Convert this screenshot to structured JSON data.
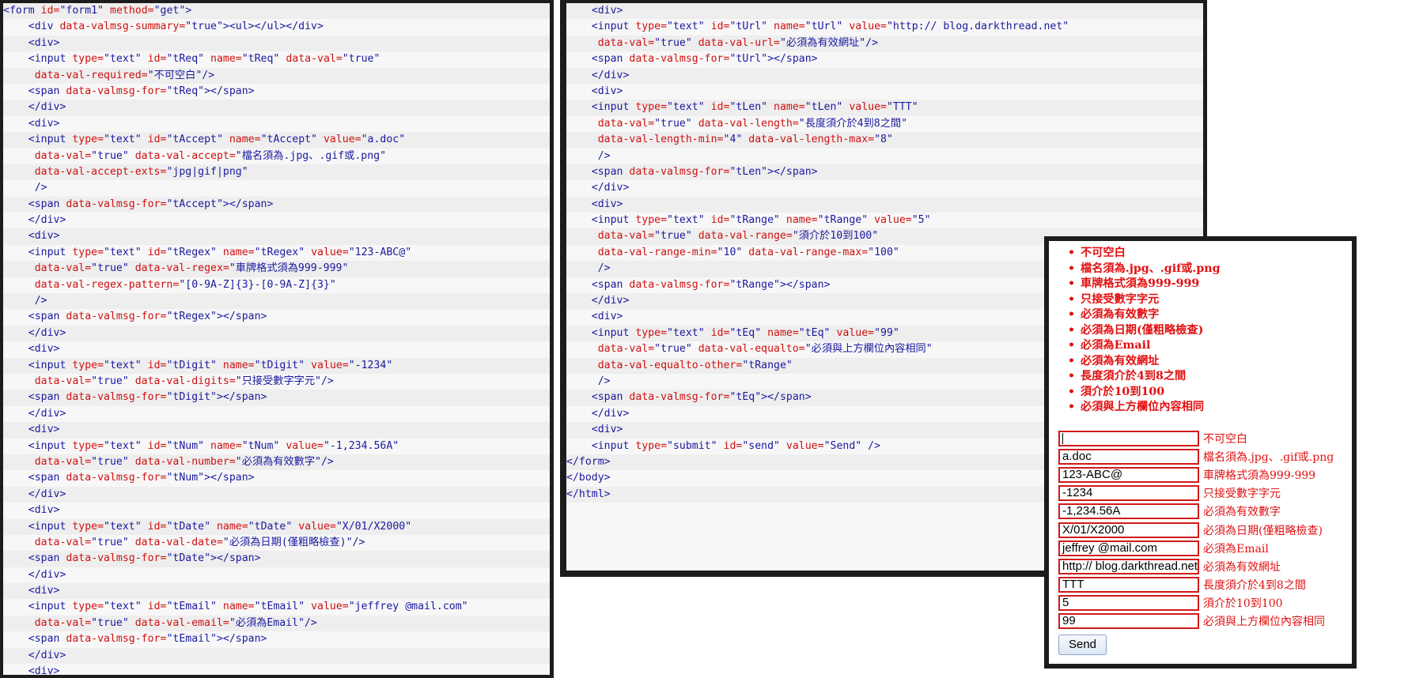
{
  "left_code": [
    [
      [
        "t",
        "<form "
      ],
      [
        "a",
        "id="
      ],
      [
        "v",
        "\"form1\" "
      ],
      [
        "a",
        "method="
      ],
      [
        "v",
        "\"get\""
      ],
      [
        "t",
        ">"
      ]
    ],
    [
      [
        "t",
        "    <div "
      ],
      [
        "a",
        "data-valmsg-summary="
      ],
      [
        "v",
        "\"true\""
      ],
      [
        "t",
        "><ul></ul></div>"
      ]
    ],
    [
      [
        "t",
        "    <div>"
      ]
    ],
    [
      [
        "t",
        "    <input "
      ],
      [
        "a",
        "type="
      ],
      [
        "v",
        "\"text\" "
      ],
      [
        "a",
        "id="
      ],
      [
        "v",
        "\"tReq\" "
      ],
      [
        "a",
        "name="
      ],
      [
        "v",
        "\"tReq\" "
      ],
      [
        "a",
        "data-val="
      ],
      [
        "v",
        "\"true\""
      ]
    ],
    [
      [
        "a",
        "     data-val-required="
      ],
      [
        "v",
        "\"不可空白\""
      ],
      [
        "t",
        "/>"
      ]
    ],
    [
      [
        "t",
        "    <span "
      ],
      [
        "a",
        "data-valmsg-for="
      ],
      [
        "v",
        "\"tReq\""
      ],
      [
        "t",
        "></span>"
      ]
    ],
    [
      [
        "t",
        "    </div>"
      ]
    ],
    [
      [
        "t",
        "    <div>"
      ]
    ],
    [
      [
        "t",
        "    <input "
      ],
      [
        "a",
        "type="
      ],
      [
        "v",
        "\"text\" "
      ],
      [
        "a",
        "id="
      ],
      [
        "v",
        "\"tAccept\" "
      ],
      [
        "a",
        "name="
      ],
      [
        "v",
        "\"tAccept\" "
      ],
      [
        "a",
        "value="
      ],
      [
        "v",
        "\"a.doc\""
      ]
    ],
    [
      [
        "a",
        "     data-val="
      ],
      [
        "v",
        "\"true\" "
      ],
      [
        "a",
        "data-val-accept="
      ],
      [
        "v",
        "\"檔名須為.jpg、.gif或.png\""
      ]
    ],
    [
      [
        "a",
        "     data-val-accept-exts="
      ],
      [
        "v",
        "\"jpg|gif|png\""
      ]
    ],
    [
      [
        "t",
        "     />"
      ]
    ],
    [
      [
        "t",
        "    <span "
      ],
      [
        "a",
        "data-valmsg-for="
      ],
      [
        "v",
        "\"tAccept\""
      ],
      [
        "t",
        "></span>"
      ]
    ],
    [
      [
        "t",
        "    </div>"
      ]
    ],
    [
      [
        "t",
        "    <div>"
      ]
    ],
    [
      [
        "t",
        "    <input "
      ],
      [
        "a",
        "type="
      ],
      [
        "v",
        "\"text\" "
      ],
      [
        "a",
        "id="
      ],
      [
        "v",
        "\"tRegex\" "
      ],
      [
        "a",
        "name="
      ],
      [
        "v",
        "\"tRegex\" "
      ],
      [
        "a",
        "value="
      ],
      [
        "v",
        "\"123-ABC@\""
      ]
    ],
    [
      [
        "a",
        "     data-val="
      ],
      [
        "v",
        "\"true\" "
      ],
      [
        "a",
        "data-val-regex="
      ],
      [
        "v",
        "\"車牌格式須為999-999\""
      ]
    ],
    [
      [
        "a",
        "     data-val-regex-pattern="
      ],
      [
        "v",
        "\"[0-9A-Z]{3}-[0-9A-Z]{3}\""
      ]
    ],
    [
      [
        "t",
        "     />"
      ]
    ],
    [
      [
        "t",
        "    <span "
      ],
      [
        "a",
        "data-valmsg-for="
      ],
      [
        "v",
        "\"tRegex\""
      ],
      [
        "t",
        "></span>"
      ]
    ],
    [
      [
        "t",
        "    </div>"
      ]
    ],
    [
      [
        "t",
        "    <div>"
      ]
    ],
    [
      [
        "t",
        "    <input "
      ],
      [
        "a",
        "type="
      ],
      [
        "v",
        "\"text\" "
      ],
      [
        "a",
        "id="
      ],
      [
        "v",
        "\"tDigit\" "
      ],
      [
        "a",
        "name="
      ],
      [
        "v",
        "\"tDigit\" "
      ],
      [
        "a",
        "value="
      ],
      [
        "v",
        "\"-1234\""
      ]
    ],
    [
      [
        "a",
        "     data-val="
      ],
      [
        "v",
        "\"true\" "
      ],
      [
        "a",
        "data-val-digits="
      ],
      [
        "v",
        "\"只接受數字字元\""
      ],
      [
        "t",
        "/>"
      ]
    ],
    [
      [
        "t",
        "    <span "
      ],
      [
        "a",
        "data-valmsg-for="
      ],
      [
        "v",
        "\"tDigit\""
      ],
      [
        "t",
        "></span>"
      ]
    ],
    [
      [
        "t",
        "    </div>"
      ]
    ],
    [
      [
        "t",
        "    <div>"
      ]
    ],
    [
      [
        "t",
        "    <input "
      ],
      [
        "a",
        "type="
      ],
      [
        "v",
        "\"text\" "
      ],
      [
        "a",
        "id="
      ],
      [
        "v",
        "\"tNum\" "
      ],
      [
        "a",
        "name="
      ],
      [
        "v",
        "\"tNum\" "
      ],
      [
        "a",
        "value="
      ],
      [
        "v",
        "\"-1,234.56A\""
      ]
    ],
    [
      [
        "a",
        "     data-val="
      ],
      [
        "v",
        "\"true\" "
      ],
      [
        "a",
        "data-val-number="
      ],
      [
        "v",
        "\"必須為有效數字\""
      ],
      [
        "t",
        "/>"
      ]
    ],
    [
      [
        "t",
        "    <span "
      ],
      [
        "a",
        "data-valmsg-for="
      ],
      [
        "v",
        "\"tNum\""
      ],
      [
        "t",
        "></span>"
      ]
    ],
    [
      [
        "t",
        "    </div>"
      ]
    ],
    [
      [
        "t",
        "    <div>"
      ]
    ],
    [
      [
        "t",
        "    <input "
      ],
      [
        "a",
        "type="
      ],
      [
        "v",
        "\"text\" "
      ],
      [
        "a",
        "id="
      ],
      [
        "v",
        "\"tDate\" "
      ],
      [
        "a",
        "name="
      ],
      [
        "v",
        "\"tDate\" "
      ],
      [
        "a",
        "value="
      ],
      [
        "v",
        "\"X/01/X2000\""
      ]
    ],
    [
      [
        "a",
        "     data-val="
      ],
      [
        "v",
        "\"true\" "
      ],
      [
        "a",
        "data-val-date="
      ],
      [
        "v",
        "\"必須為日期(僅粗略檢查)\""
      ],
      [
        "t",
        "/>"
      ]
    ],
    [
      [
        "t",
        "    <span "
      ],
      [
        "a",
        "data-valmsg-for="
      ],
      [
        "v",
        "\"tDate\""
      ],
      [
        "t",
        "></span>"
      ]
    ],
    [
      [
        "t",
        "    </div>"
      ]
    ],
    [
      [
        "t",
        "    <div>"
      ]
    ],
    [
      [
        "t",
        "    <input "
      ],
      [
        "a",
        "type="
      ],
      [
        "v",
        "\"text\" "
      ],
      [
        "a",
        "id="
      ],
      [
        "v",
        "\"tEmail\" "
      ],
      [
        "a",
        "name="
      ],
      [
        "v",
        "\"tEmail\" "
      ],
      [
        "a",
        "value="
      ],
      [
        "v",
        "\"jeffrey @mail.com\""
      ]
    ],
    [
      [
        "a",
        "     data-val="
      ],
      [
        "v",
        "\"true\" "
      ],
      [
        "a",
        "data-val-email="
      ],
      [
        "v",
        "\"必須為Email\""
      ],
      [
        "t",
        "/>"
      ]
    ],
    [
      [
        "t",
        "    <span "
      ],
      [
        "a",
        "data-valmsg-for="
      ],
      [
        "v",
        "\"tEmail\""
      ],
      [
        "t",
        "></span>"
      ]
    ],
    [
      [
        "t",
        "    </div>"
      ]
    ],
    [
      [
        "t",
        "    <div>"
      ]
    ]
  ],
  "middle_code": [
    [
      [
        "t",
        "    <div>"
      ]
    ],
    [
      [
        "t",
        "    <input "
      ],
      [
        "a",
        "type="
      ],
      [
        "v",
        "\"text\" "
      ],
      [
        "a",
        "id="
      ],
      [
        "v",
        "\"tUrl\" "
      ],
      [
        "a",
        "name="
      ],
      [
        "v",
        "\"tUrl\" "
      ],
      [
        "a",
        "value="
      ],
      [
        "v",
        "\"http:// blog.darkthread.net\""
      ]
    ],
    [
      [
        "a",
        "     data-val="
      ],
      [
        "v",
        "\"true\" "
      ],
      [
        "a",
        "data-val-url="
      ],
      [
        "v",
        "\"必須為有效網址\""
      ],
      [
        "t",
        "/>"
      ]
    ],
    [
      [
        "t",
        "    <span "
      ],
      [
        "a",
        "data-valmsg-for="
      ],
      [
        "v",
        "\"tUrl\""
      ],
      [
        "t",
        "></span>"
      ]
    ],
    [
      [
        "t",
        "    </div>"
      ]
    ],
    [
      [
        "t",
        "    <div>"
      ]
    ],
    [
      [
        "t",
        "    <input "
      ],
      [
        "a",
        "type="
      ],
      [
        "v",
        "\"text\" "
      ],
      [
        "a",
        "id="
      ],
      [
        "v",
        "\"tLen\" "
      ],
      [
        "a",
        "name="
      ],
      [
        "v",
        "\"tLen\" "
      ],
      [
        "a",
        "value="
      ],
      [
        "v",
        "\"TTT\""
      ]
    ],
    [
      [
        "a",
        "     data-val="
      ],
      [
        "v",
        "\"true\" "
      ],
      [
        "a",
        "data-val-length="
      ],
      [
        "v",
        "\"長度須介於4到8之間\""
      ]
    ],
    [
      [
        "a",
        "     data-val-length-min="
      ],
      [
        "v",
        "\"4\" "
      ],
      [
        "a",
        "data-val-length-max="
      ],
      [
        "v",
        "\"8\""
      ]
    ],
    [
      [
        "t",
        "     />"
      ]
    ],
    [
      [
        "t",
        "    <span "
      ],
      [
        "a",
        "data-valmsg-for="
      ],
      [
        "v",
        "\"tLen\""
      ],
      [
        "t",
        "></span>"
      ]
    ],
    [
      [
        "t",
        "    </div>"
      ]
    ],
    [
      [
        "t",
        "    <div>"
      ]
    ],
    [
      [
        "t",
        "    <input "
      ],
      [
        "a",
        "type="
      ],
      [
        "v",
        "\"text\" "
      ],
      [
        "a",
        "id="
      ],
      [
        "v",
        "\"tRange\" "
      ],
      [
        "a",
        "name="
      ],
      [
        "v",
        "\"tRange\" "
      ],
      [
        "a",
        "value="
      ],
      [
        "v",
        "\"5\""
      ]
    ],
    [
      [
        "a",
        "     data-val="
      ],
      [
        "v",
        "\"true\" "
      ],
      [
        "a",
        "data-val-range="
      ],
      [
        "v",
        "\"須介於10到100\""
      ]
    ],
    [
      [
        "a",
        "     data-val-range-min="
      ],
      [
        "v",
        "\"10\" "
      ],
      [
        "a",
        "data-val-range-max="
      ],
      [
        "v",
        "\"100\""
      ]
    ],
    [
      [
        "t",
        "     />"
      ]
    ],
    [
      [
        "t",
        "    <span "
      ],
      [
        "a",
        "data-valmsg-for="
      ],
      [
        "v",
        "\"tRange\""
      ],
      [
        "t",
        "></span>"
      ]
    ],
    [
      [
        "t",
        "    </div>"
      ]
    ],
    [
      [
        "t",
        "    <div>"
      ]
    ],
    [
      [
        "t",
        "    <input "
      ],
      [
        "a",
        "type="
      ],
      [
        "v",
        "\"text\" "
      ],
      [
        "a",
        "id="
      ],
      [
        "v",
        "\"tEq\" "
      ],
      [
        "a",
        "name="
      ],
      [
        "v",
        "\"tEq\" "
      ],
      [
        "a",
        "value="
      ],
      [
        "v",
        "\"99\""
      ]
    ],
    [
      [
        "a",
        "     data-val="
      ],
      [
        "v",
        "\"true\" "
      ],
      [
        "a",
        "data-val-equalto="
      ],
      [
        "v",
        "\"必須與上方欄位內容相同\""
      ]
    ],
    [
      [
        "a",
        "     data-val-equalto-other="
      ],
      [
        "v",
        "\"tRange\""
      ]
    ],
    [
      [
        "t",
        "     />"
      ]
    ],
    [
      [
        "t",
        "    <span "
      ],
      [
        "a",
        "data-valmsg-for="
      ],
      [
        "v",
        "\"tEq\""
      ],
      [
        "t",
        "></span>"
      ]
    ],
    [
      [
        "t",
        "    </div>"
      ]
    ],
    [
      [
        "t",
        "    <div>"
      ]
    ],
    [
      [
        "t",
        "    <input "
      ],
      [
        "a",
        "type="
      ],
      [
        "v",
        "\"submit\" "
      ],
      [
        "a",
        "id="
      ],
      [
        "v",
        "\"send\" "
      ],
      [
        "a",
        "value="
      ],
      [
        "v",
        "\"Send\" "
      ],
      [
        "t",
        "/>"
      ]
    ],
    [
      [
        "t",
        "</form>"
      ]
    ],
    [
      [
        "t",
        "</body>"
      ]
    ],
    [
      [
        "t",
        "</html>"
      ]
    ]
  ],
  "result": {
    "summary": [
      "不可空白",
      "檔名須為.jpg、.gif或.png",
      "車牌格式須為999-999",
      "只接受數字字元",
      "必須為有效數字",
      "必須為日期(僅粗略檢查)",
      "必須為Email",
      "必須為有效網址",
      "長度須介於4到8之間",
      "須介於10到100",
      "必須與上方欄位內容相同"
    ],
    "fields": [
      {
        "value": "",
        "message": "不可空白"
      },
      {
        "value": "a.doc",
        "message": "檔名須為.jpg、.gif或.png"
      },
      {
        "value": "123-ABC@",
        "message": "車牌格式須為999-999"
      },
      {
        "value": "-1234",
        "message": "只接受數字字元"
      },
      {
        "value": "-1,234.56A",
        "message": "必須為有效數字"
      },
      {
        "value": "X/01/X2000",
        "message": "必須為日期(僅粗略檢查)"
      },
      {
        "value": "jeffrey @mail.com",
        "message": "必須為Email"
      },
      {
        "value": "http:// blog.darkthread.net",
        "message": "必須為有效網址"
      },
      {
        "value": "TTT",
        "message": "長度須介於4到8之間"
      },
      {
        "value": "5",
        "message": "須介於10到100"
      },
      {
        "value": "99",
        "message": "必須與上方欄位內容相同"
      }
    ],
    "send_label": "Send"
  },
  "colors": {
    "error": "#e21010",
    "code_tag": "#1a1aa0",
    "code_attr": "#d01010",
    "frame": "#1c1c1c"
  }
}
